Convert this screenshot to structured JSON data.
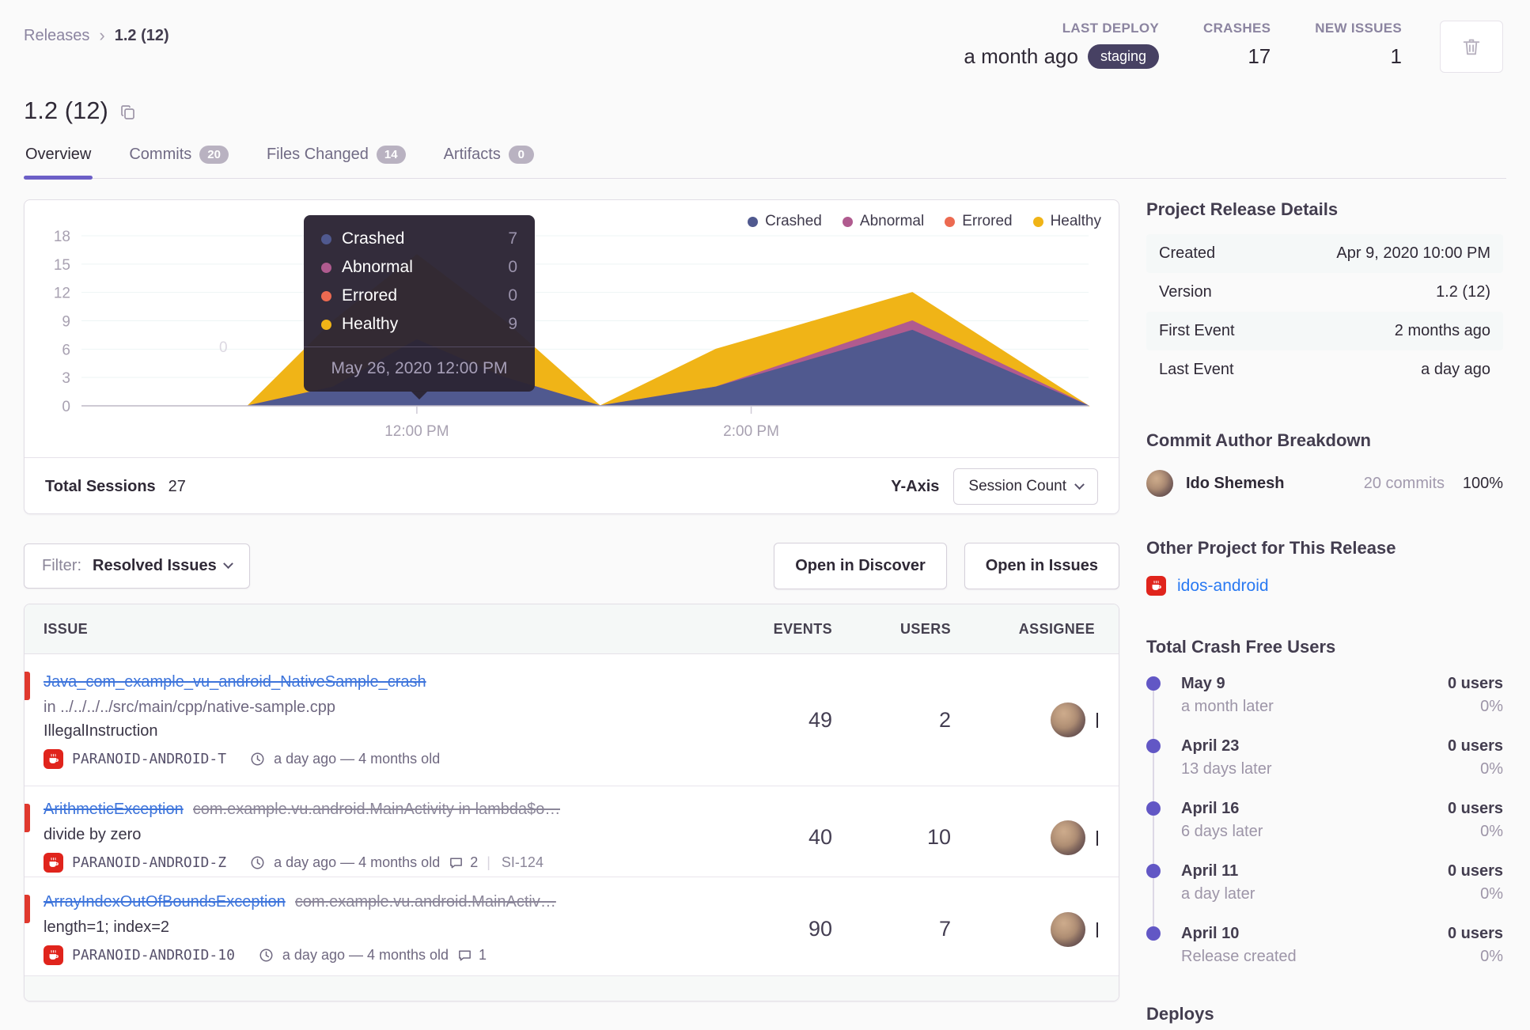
{
  "breadcrumb": {
    "root": "Releases",
    "current": "1.2 (12)"
  },
  "header_stats": {
    "last_deploy": {
      "label": "LAST DEPLOY",
      "value": "a month ago",
      "env": "staging"
    },
    "crashes": {
      "label": "CRASHES",
      "value": "17"
    },
    "new_issues": {
      "label": "NEW ISSUES",
      "value": "1"
    }
  },
  "page": {
    "title": "1.2 (12)"
  },
  "tabs": [
    {
      "label": "Overview"
    },
    {
      "label": "Commits",
      "badge": "20"
    },
    {
      "label": "Files Changed",
      "badge": "14"
    },
    {
      "label": "Artifacts",
      "badge": "0"
    }
  ],
  "chart_data": {
    "type": "area",
    "stacked": true,
    "ylim": [
      0,
      18
    ],
    "yticks": [
      0,
      3,
      6,
      9,
      12,
      15,
      18
    ],
    "xticks": [
      {
        "label": "12:00 PM",
        "f": 0.333
      },
      {
        "label": "2:00 PM",
        "f": 0.665
      }
    ],
    "legend": [
      "Crashed",
      "Abnormal",
      "Errored",
      "Healthy"
    ],
    "colors": {
      "Crashed": "#50598f",
      "Abnormal": "#b05b8f",
      "Errored": "#ec6a51",
      "Healthy": "#f0b417"
    },
    "points": [
      {
        "f": 0.0,
        "crashed": 0,
        "abnormal": 0,
        "errored": 0,
        "healthy": 0
      },
      {
        "f": 0.165,
        "crashed": 0,
        "abnormal": 0,
        "errored": 0,
        "healthy": 0
      },
      {
        "f": 0.25,
        "crashed": 2,
        "abnormal": 0,
        "errored": 0,
        "healthy": 7
      },
      {
        "f": 0.333,
        "crashed": 7,
        "abnormal": 0,
        "errored": 0,
        "healthy": 9
      },
      {
        "f": 0.42,
        "crashed": 3,
        "abnormal": 0,
        "errored": 0,
        "healthy": 6
      },
      {
        "f": 0.515,
        "crashed": 0,
        "abnormal": 0,
        "errored": 0,
        "healthy": 0
      },
      {
        "f": 0.63,
        "crashed": 2,
        "abnormal": 0,
        "errored": 0,
        "healthy": 4
      },
      {
        "f": 0.825,
        "crashed": 8,
        "abnormal": 1,
        "errored": 0,
        "healthy": 3
      },
      {
        "f": 1.0,
        "crashed": 0,
        "abnormal": 0,
        "errored": 0,
        "healthy": 0
      }
    ],
    "tooltip": {
      "rows": [
        {
          "label": "Crashed",
          "value": "7"
        },
        {
          "label": "Abnormal",
          "value": "0"
        },
        {
          "label": "Errored",
          "value": "0"
        },
        {
          "label": "Healthy",
          "value": "9"
        }
      ],
      "date": "May 26, 2020 12:00 PM"
    },
    "watermark": "0"
  },
  "chart_footer": {
    "total_label": "Total Sessions",
    "total_value": "27",
    "yaxis_label": "Y-Axis",
    "yaxis_value": "Session Count"
  },
  "filter": {
    "label": "Filter:",
    "value": "Resolved Issues"
  },
  "actions": {
    "discover": "Open in Discover",
    "issues": "Open in Issues"
  },
  "issues_table": {
    "columns": [
      "ISSUE",
      "EVENTS",
      "USERS",
      "ASSIGNEE"
    ],
    "rows": [
      {
        "title": "Java_com_example_vu_android_NativeSample_crash",
        "culprit": "",
        "line2": "in ../../../../src/main/cpp/native-sample.cpp",
        "line3": "IllegalInstruction",
        "short_id": "PARANOID-ANDROID-T",
        "age": "a day ago — 4 months old",
        "comments": "",
        "link": "",
        "events": "49",
        "users": "2"
      },
      {
        "title": "ArithmeticException",
        "culprit": "com.example.vu.android.MainActivity in lambda$o…",
        "line2": "divide by zero",
        "line3": "",
        "short_id": "PARANOID-ANDROID-Z",
        "age": "a day ago — 4 months old",
        "comments": "2",
        "link": "SI-124",
        "events": "40",
        "users": "10"
      },
      {
        "title": "ArrayIndexOutOfBoundsException",
        "culprit": "com.example.vu.android.MainActiv…",
        "line2": "length=1; index=2",
        "line3": "",
        "short_id": "PARANOID-ANDROID-10",
        "age": "a day ago — 4 months old",
        "comments": "1",
        "link": "",
        "events": "90",
        "users": "7"
      }
    ]
  },
  "sidebar": {
    "details": {
      "heading": "Project Release Details",
      "rows": [
        {
          "k": "Created",
          "v": "Apr 9, 2020 10:00 PM"
        },
        {
          "k": "Version",
          "v": "1.2 (12)"
        },
        {
          "k": "First Event",
          "v": "2 months ago"
        },
        {
          "k": "Last Event",
          "v": "a day ago"
        }
      ]
    },
    "authors": {
      "heading": "Commit Author Breakdown",
      "name": "Ido Shemesh",
      "commits": "20 commits",
      "percent": "100%"
    },
    "other_project": {
      "heading": "Other Project for This Release",
      "name": "idos-android"
    },
    "crash_free": {
      "heading": "Total Crash Free Users",
      "entries": [
        {
          "date": "May 9",
          "sub": "a month later",
          "users": "0 users",
          "pct": "0%"
        },
        {
          "date": "April 23",
          "sub": "13 days later",
          "users": "0 users",
          "pct": "0%"
        },
        {
          "date": "April 16",
          "sub": "6 days later",
          "users": "0 users",
          "pct": "0%"
        },
        {
          "date": "April 11",
          "sub": "a day later",
          "users": "0 users",
          "pct": "0%"
        },
        {
          "date": "April 10",
          "sub": "Release created",
          "users": "0 users",
          "pct": "0%"
        }
      ]
    },
    "deploys_heading": "Deploys"
  }
}
